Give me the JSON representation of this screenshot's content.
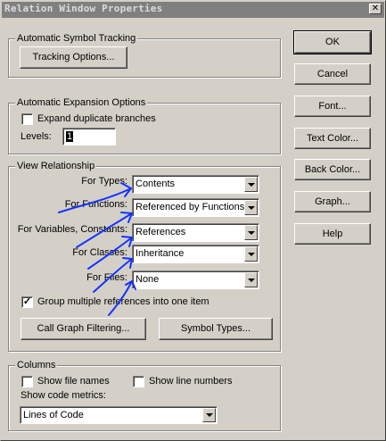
{
  "window": {
    "title": "Relation Window Properties",
    "close_glyph": "✕"
  },
  "symbol_tracking": {
    "group_label": "Automatic Symbol Tracking",
    "tracking_button": "Tracking Options..."
  },
  "expansion": {
    "group_label": "Automatic Expansion Options",
    "expand_duplicates_label": "Expand duplicate branches",
    "expand_duplicates_checked": false,
    "levels_label": "Levels:",
    "levels_value": "1"
  },
  "view_relationship": {
    "group_label": "View Relationship",
    "for_types_label": "For Types:",
    "for_types_value": "Contents",
    "for_functions_label": "For Functions:",
    "for_functions_value": "Referenced by Functions",
    "for_variables_label": "For Variables, Constants:",
    "for_variables_value": "References",
    "for_classes_label": "For Classes:",
    "for_classes_value": "Inheritance",
    "for_files_label": "For Files:",
    "for_files_value": "None",
    "group_refs_label": "Group multiple references into one item",
    "group_refs_checked": true,
    "check_glyph": "✓",
    "call_graph_button": "Call Graph Filtering...",
    "symbol_types_button": "Symbol Types..."
  },
  "columns": {
    "group_label": "Columns",
    "show_file_names_label": "Show file names",
    "show_file_names_checked": false,
    "show_line_numbers_label": "Show line numbers",
    "show_line_numbers_checked": false,
    "show_code_metrics_label": "Show code metrics:",
    "code_metrics_value": "Lines of Code"
  },
  "side_buttons": {
    "ok": "OK",
    "cancel": "Cancel",
    "font": "Font...",
    "text_color": "Text Color...",
    "back_color": "Back Color...",
    "graph": "Graph...",
    "help": "Help"
  }
}
